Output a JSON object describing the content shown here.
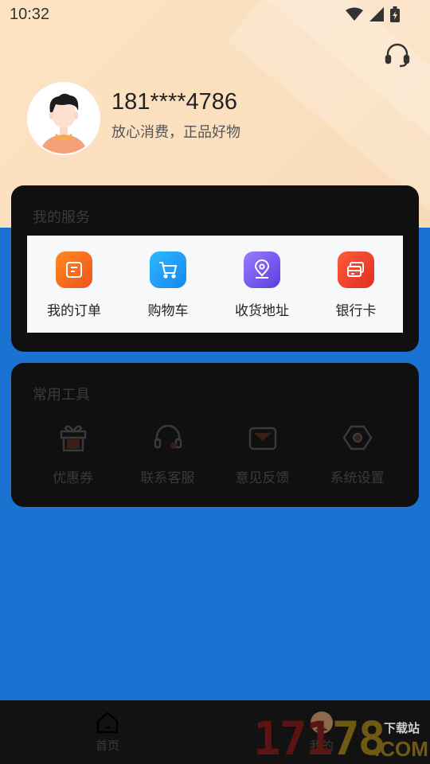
{
  "status_bar": {
    "time": "10:32"
  },
  "profile": {
    "phone": "181****4786",
    "slogan": "放心消费，正品好物"
  },
  "services": {
    "title": "我的服务",
    "items": [
      {
        "label": "我的订单",
        "icon": "order-icon",
        "color": "#f5731f"
      },
      {
        "label": "购物车",
        "icon": "cart-icon",
        "color": "#1aa0f0"
      },
      {
        "label": "收货地址",
        "icon": "location-icon",
        "color": "#7a5cf0"
      },
      {
        "label": "银行卡",
        "icon": "bank-card-icon",
        "color": "#f0472d"
      }
    ]
  },
  "tools": {
    "title": "常用工具",
    "items": [
      {
        "label": "优惠券",
        "icon": "coupon-icon"
      },
      {
        "label": "联系客服",
        "icon": "customer-service-icon"
      },
      {
        "label": "意见反馈",
        "icon": "feedback-icon"
      },
      {
        "label": "系统设置",
        "icon": "settings-icon"
      }
    ]
  },
  "tabbar": {
    "items": [
      {
        "label": "首页",
        "icon": "home-icon"
      },
      {
        "label": "我的",
        "icon": "profile-icon"
      }
    ]
  },
  "watermark": {
    "number": "17178",
    "site": "下载站",
    "domain": ".COM"
  }
}
